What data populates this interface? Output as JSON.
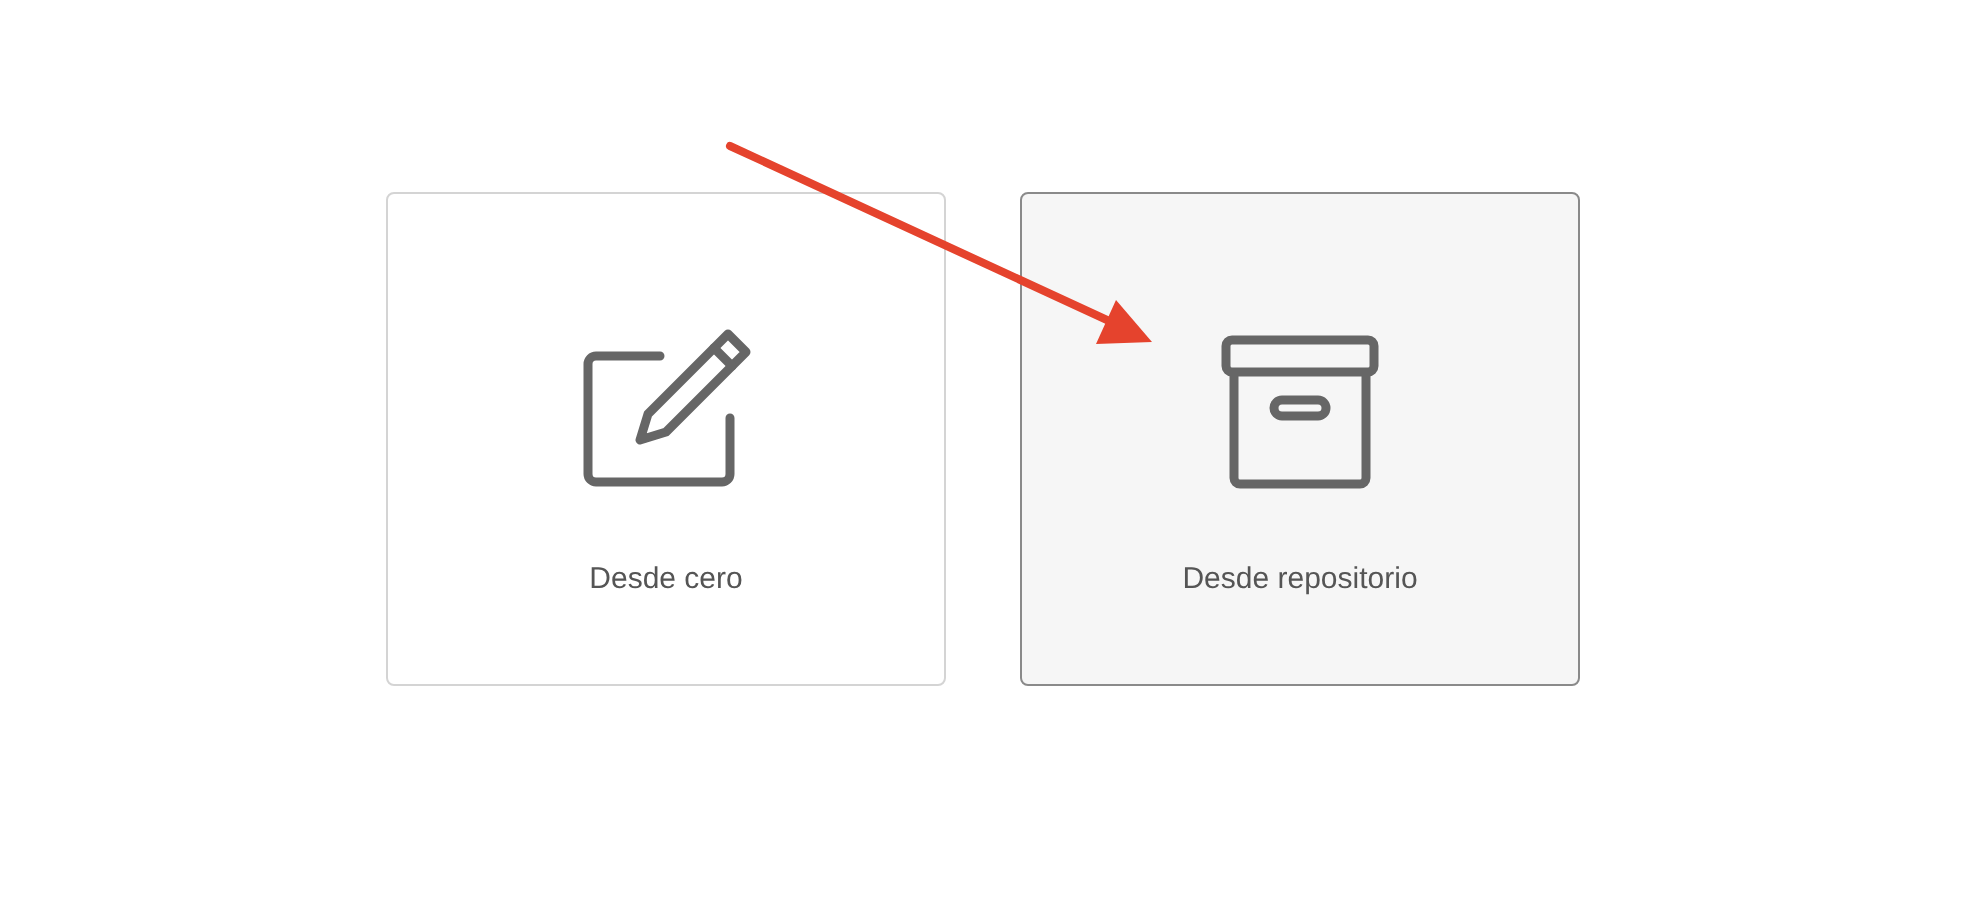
{
  "options": [
    {
      "label": "Desde cero",
      "kind": "edit",
      "selected": false
    },
    {
      "label": "Desde repositorio",
      "kind": "archive",
      "selected": true
    }
  ]
}
